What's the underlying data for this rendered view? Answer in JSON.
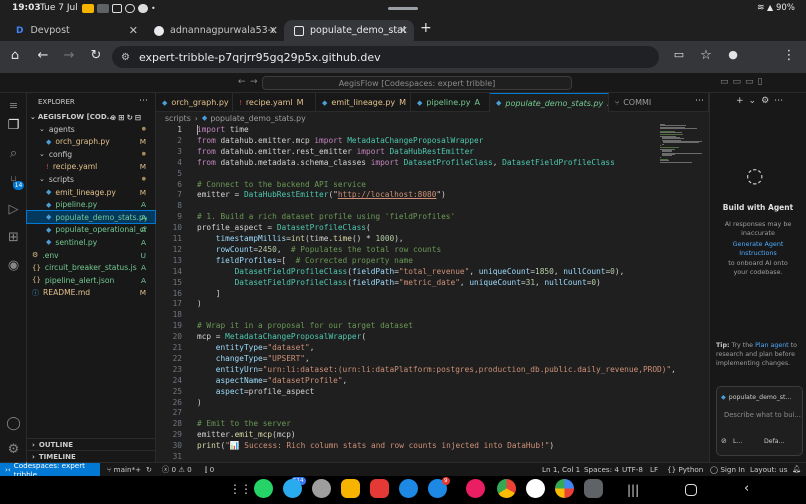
{
  "status_bar": {
    "time": "19:03",
    "date": "Tue 7 Jul",
    "battery": "90%"
  },
  "browser_tabs": [
    {
      "favicon": "D",
      "label": "Devpost",
      "active": false
    },
    {
      "favicon": "github-icon",
      "label": "adnannagpurwala53-oss/A",
      "active": false
    },
    {
      "favicon": "codespaces-icon",
      "label": "populate_demo_stats.py -",
      "active": true
    }
  ],
  "omnibox": {
    "url": "expert-tribble-p7qrjrr95gq29p5x.github.dev",
    "tab_count": "3"
  },
  "vscode": {
    "command_center": "AegisFlow [Codespaces: expert tribble]",
    "explorer": {
      "header": "EXPLORER",
      "root": "AEGISFLOW [COD...",
      "items": [
        {
          "label": "agents",
          "type": "folder",
          "status": ""
        },
        {
          "label": "orch_graph.py",
          "type": "py",
          "status": "M"
        },
        {
          "label": "config",
          "type": "folder",
          "status": ""
        },
        {
          "label": "recipe.yaml",
          "type": "yaml",
          "status": "M"
        },
        {
          "label": "scripts",
          "type": "folder",
          "status": ""
        },
        {
          "label": "emit_lineage.py",
          "type": "py",
          "status": "M"
        },
        {
          "label": "pipeline.py",
          "type": "py",
          "status": "A"
        },
        {
          "label": "populate_demo_stats.py",
          "type": "py",
          "status": "A"
        },
        {
          "label": "populate_operational_cha...",
          "type": "py",
          "status": "A"
        },
        {
          "label": "sentinel.py",
          "type": "py",
          "status": "A"
        },
        {
          "label": ".env",
          "type": "env",
          "status": "U"
        },
        {
          "label": "circuit_breaker_status.json",
          "type": "json",
          "status": "A"
        },
        {
          "label": "pipeline_alert.json",
          "type": "json",
          "status": "A"
        },
        {
          "label": "README.md",
          "type": "md",
          "status": "M"
        }
      ],
      "outline": "OUTLINE",
      "timeline": "TIMELINE"
    },
    "editor_tabs": [
      {
        "label": "orch_graph.py",
        "status": "M"
      },
      {
        "label": "recipe.yaml",
        "status": "M"
      },
      {
        "label": "emit_lineage.py",
        "status": "M"
      },
      {
        "label": "pipeline.py",
        "status": "A"
      },
      {
        "label": "populate_demo_stats.py",
        "status": "A"
      },
      {
        "label": "COMMI",
        "status": ""
      }
    ],
    "breadcrumb": {
      "folder": "scripts",
      "file": "populate_demo_stats.py"
    },
    "code_lines": [
      {
        "n": "1",
        "text": "import time"
      },
      {
        "n": "2",
        "text": "from datahub.emitter.mcp import MetadataChangeProposalWrapper"
      },
      {
        "n": "3",
        "text": "from datahub.emitter.rest_emitter import DataHubRestEmitter"
      },
      {
        "n": "4",
        "text": "from datahub.metadata.schema_classes import DatasetProfileClass, DatasetFieldProfileClass"
      },
      {
        "n": "5",
        "text": ""
      },
      {
        "n": "6",
        "text": "# Connect to the backend API service"
      },
      {
        "n": "7",
        "text": "emitter = DataHubRestEmitter(\"http://localhost:8080\")"
      },
      {
        "n": "8",
        "text": ""
      },
      {
        "n": "9",
        "text": "# 1. Build a rich dataset profile using 'fieldProfiles'"
      },
      {
        "n": "10",
        "text": "profile_aspect = DatasetProfileClass("
      },
      {
        "n": "11",
        "text": "    timestampMillis=int(time.time() * 1000),"
      },
      {
        "n": "12",
        "text": "    rowCount=2450,  # Populates the total row counts"
      },
      {
        "n": "13",
        "text": "    fieldProfiles=[  # Corrected property name"
      },
      {
        "n": "14",
        "text": "        DatasetFieldProfileClass(fieldPath=\"total_revenue\", uniqueCount=1850, nullCount=0),"
      },
      {
        "n": "15",
        "text": "        DatasetFieldProfileClass(fieldPath=\"metric_date\", uniqueCount=31, nullCount=0)"
      },
      {
        "n": "16",
        "text": "    ]"
      },
      {
        "n": "17",
        "text": ")"
      },
      {
        "n": "18",
        "text": ""
      },
      {
        "n": "19",
        "text": "# Wrap it in a proposal for our target dataset"
      },
      {
        "n": "20",
        "text": "mcp = MetadataChangeProposalWrapper("
      },
      {
        "n": "21",
        "text": "    entityType=\"dataset\","
      },
      {
        "n": "22",
        "text": "    changeType=\"UPSERT\","
      },
      {
        "n": "23",
        "text": "    entityUrn=\"urn:li:dataset:(urn:li:dataPlatform:postgres,production_db.public.daily_revenue,PROD)\","
      },
      {
        "n": "24",
        "text": "    aspectName=\"datasetProfile\","
      },
      {
        "n": "25",
        "text": "    aspect=profile_aspect"
      },
      {
        "n": "26",
        "text": ")"
      },
      {
        "n": "27",
        "text": ""
      },
      {
        "n": "28",
        "text": "# Emit to the server"
      },
      {
        "n": "29",
        "text": "emitter.emit_mcp(mcp)"
      },
      {
        "n": "30",
        "text": "print(\"📊 Success: Rich column stats and row counts injected into DataHub!\")"
      },
      {
        "n": "31",
        "text": ""
      }
    ],
    "chat": {
      "title": "Build with Agent",
      "disclaimer_1": "AI responses may be inaccurate",
      "link": "Generate Agent Instructions",
      "disclaimer_2": "to onboard AI onto your codebase.",
      "tip_prefix": "Tip:",
      "tip_mid": " Try the ",
      "tip_link": "Plan agent",
      "tip_rest": " to research and plan before implementing changes.",
      "context_file": "populate_demo_st...",
      "input_placeholder": "Describe what to bui...",
      "agent_label": "L...",
      "model_label": "Defa..."
    },
    "status": {
      "remote": "Codespaces: expert tribble",
      "branch": "main*+",
      "problems_err": "0",
      "problems_warn": "0",
      "ports": "0",
      "position": "Ln 1, Col 1",
      "spaces": "Spaces: 4",
      "encoding": "UTF-8",
      "eol": "LF",
      "language": "Python",
      "sign_in": "Sign In",
      "layout": "Layout: us"
    }
  },
  "dock": {
    "whatsapp_badge": "514",
    "chat_badge": "9"
  },
  "colors": {
    "accent": "#0078d4",
    "modified": "#e2c08d",
    "added": "#73c991",
    "untracked": "#73c991"
  }
}
